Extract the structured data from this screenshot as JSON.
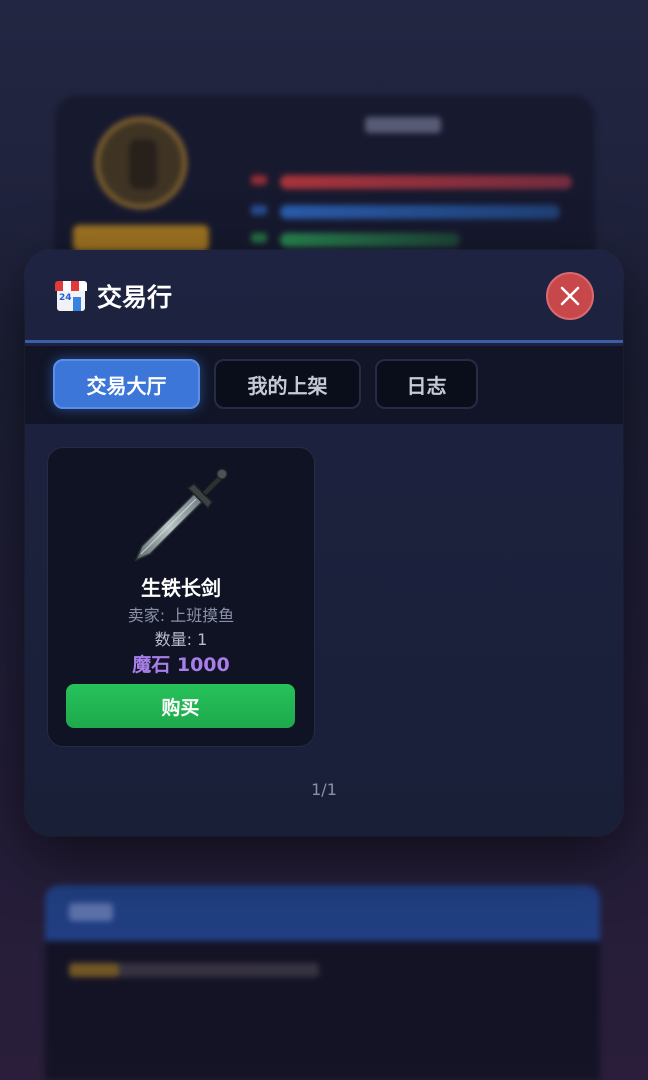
{
  "modal": {
    "title": "交易行",
    "title_icon": "convenience-store-icon",
    "title_icon_text": "24",
    "close_icon": "close-icon"
  },
  "tabs": [
    {
      "label": "交易大厅",
      "active": true
    },
    {
      "label": "我的上架",
      "active": false
    },
    {
      "label": "日志",
      "active": false
    }
  ],
  "listings": [
    {
      "icon": "sword-icon",
      "name": "生铁长剑",
      "seller": "卖家: 上班摸鱼",
      "quantity": "数量: 1",
      "price": "魔石 1000",
      "buy_label": "购买"
    }
  ],
  "pagination": "1/1",
  "colors": {
    "active_tab": "#3b76d8",
    "buy_button": "#22b553",
    "price": "#a87ee8",
    "close_button": "#c8474b"
  }
}
